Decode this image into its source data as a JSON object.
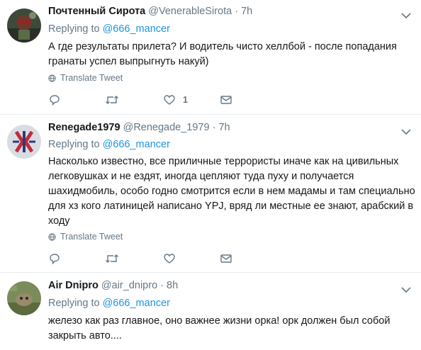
{
  "tweets": [
    {
      "name": "Почтенный Сирота",
      "handle": "@VenerableSirota",
      "time": "· 7h",
      "replying_prefix": "Replying to",
      "replying_to": "@666_mancer",
      "text": "А где результаты прилета? И водитель чисто хеллбой - после попадания гранаты успел выпрыгнуть накуй)",
      "translate": "Translate Tweet",
      "like_count": "1"
    },
    {
      "name": "Renegade1979",
      "handle": "@Renegade_1979",
      "time": "· 7h",
      "replying_prefix": "Replying to",
      "replying_to": "@666_mancer",
      "text": "Насколько известно, все приличные террористы иначе как на цивильных легковушках и не ездят, иногда цепляют туда пуху и получается шахидмобиль, особо годно смотрится если в нем мадамы и там специально для хз кого латиницей написано YPJ, вряд ли местные ее знают, арабский в ходу",
      "translate": "Translate Tweet",
      "like_count": ""
    },
    {
      "name": "Air Dnipro",
      "handle": "@air_dnipro",
      "time": "· 8h",
      "replying_prefix": "Replying to",
      "replying_to": "@666_mancer",
      "text": "железо как раз главное, оно важнее жизни орка! орк должен был собой закрыть авто....",
      "translate": "",
      "like_count": ""
    }
  ],
  "colors": {
    "name": "#14171a",
    "muted": "#657786",
    "link": "#1b95e0",
    "divider": "#e6ecf0"
  }
}
